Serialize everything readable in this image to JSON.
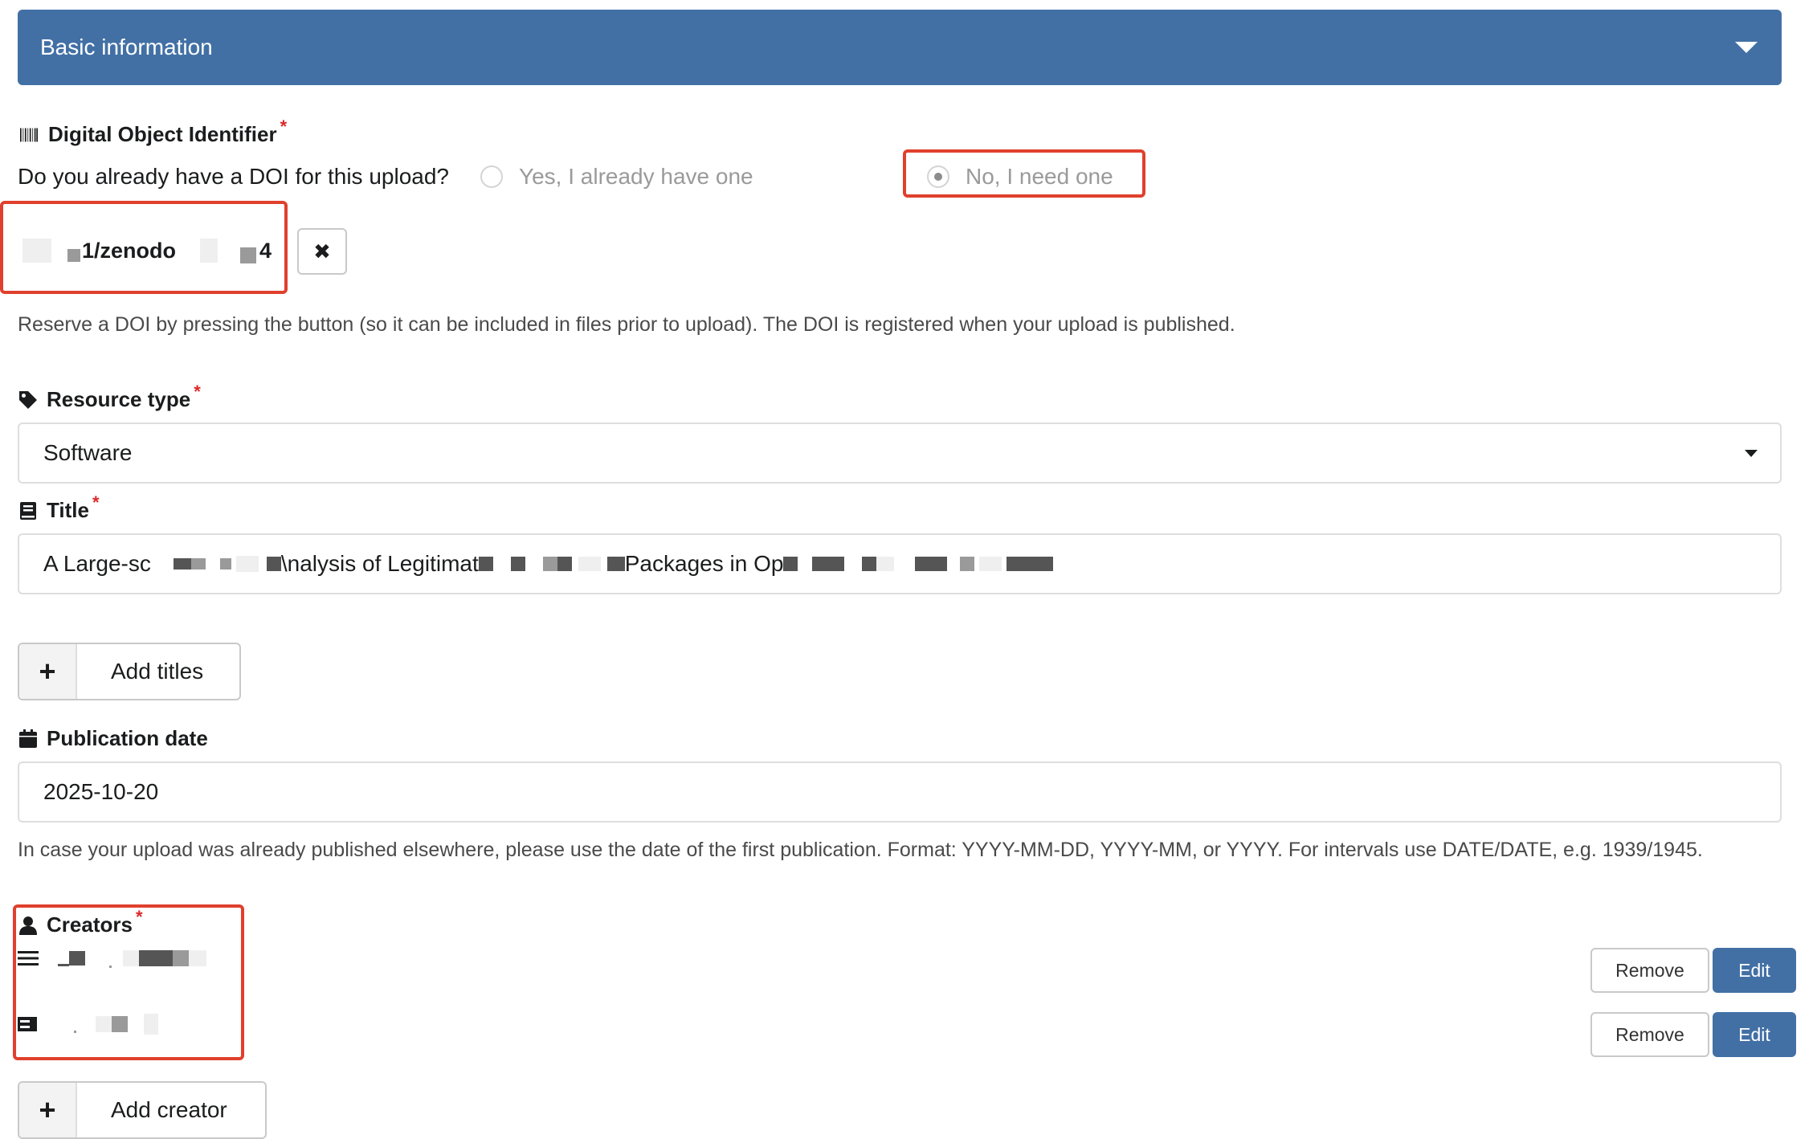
{
  "accordion": {
    "title": "Basic information"
  },
  "doi": {
    "label": "Digital Object Identifier",
    "required_mark": "*",
    "question": "Do you already have a DOI for this upload?",
    "option_yes": "Yes, I already have one",
    "option_no": "No, I need one",
    "selected": "No, I need one",
    "reserved_value": "1/zenodo",
    "reserved_suffix": "4",
    "clear_icon": "✖",
    "help": "Reserve a DOI by pressing the button (so it can be included in files prior to upload). The DOI is registered when your upload is published."
  },
  "resource_type": {
    "label": "Resource type",
    "required_mark": "*",
    "value": "Software"
  },
  "title_field": {
    "label": "Title",
    "required_mark": "*",
    "value_parts": [
      "A Large-sc",
      "\\nalysis of Legitimat",
      " Packages in Op"
    ]
  },
  "add_titles": {
    "plus": "+",
    "label": "Add titles"
  },
  "publication_date": {
    "label": "Publication date",
    "value": "2025-10-20",
    "help": "In case your upload was already published elsewhere, please use the date of the first publication. Format: YYYY-MM-DD, YYYY-MM, or YYYY. For intervals use DATE/DATE, e.g. 1939/1945."
  },
  "creators": {
    "label": "Creators",
    "required_mark": "*",
    "rows": [
      {
        "remove_label": "Remove",
        "edit_label": "Edit"
      },
      {
        "remove_label": "Remove",
        "edit_label": "Edit"
      }
    ]
  },
  "add_creator": {
    "plus": "+",
    "label": "Add creator"
  },
  "colors": {
    "accent": "#4270a5",
    "required": "#db2828",
    "highlight": "#e0402d"
  }
}
